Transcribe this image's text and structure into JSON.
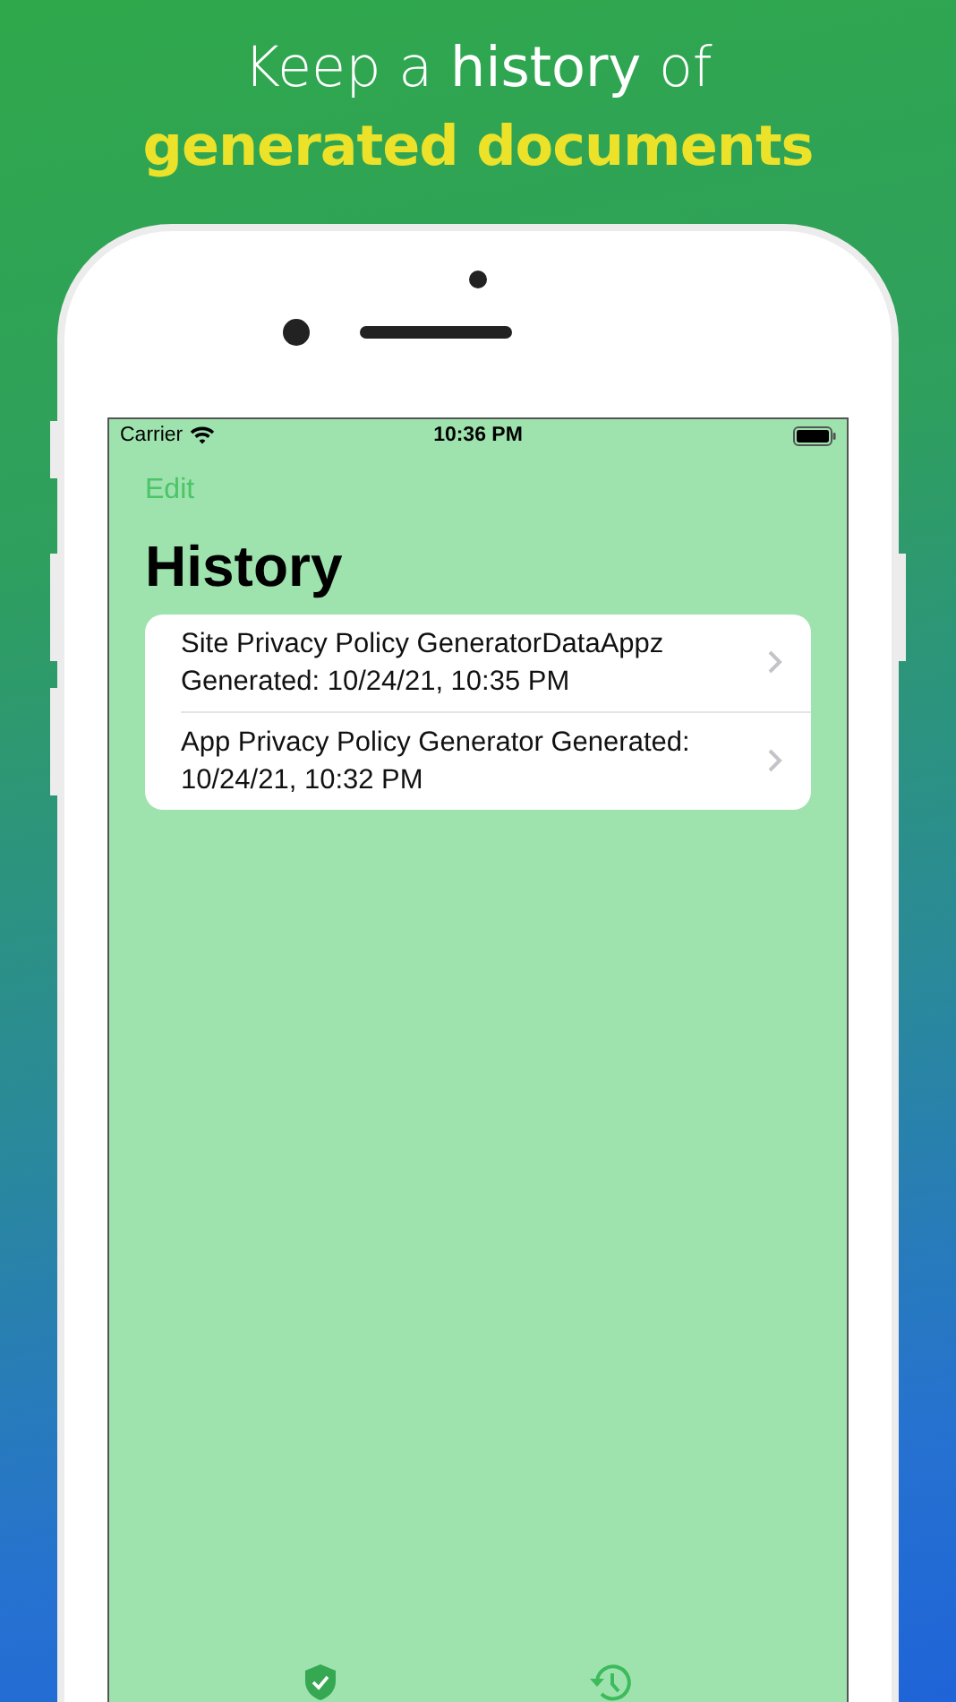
{
  "headline": {
    "line_1": "Keep a **history** of",
    "line_2": "generated documents"
  },
  "status_bar": {
    "carrier": "Carrier",
    "time": "10:36 PM"
  },
  "nav": {
    "edit": "Edit",
    "title": "History"
  },
  "rows": [
    {
      "text": "Site Privacy Policy GeneratorDataAppz Generated: 10/24/21, 10:35 PM"
    },
    {
      "text": "App Privacy Policy Generator Generated: 10/24/21, 10:32 PM"
    }
  ]
}
